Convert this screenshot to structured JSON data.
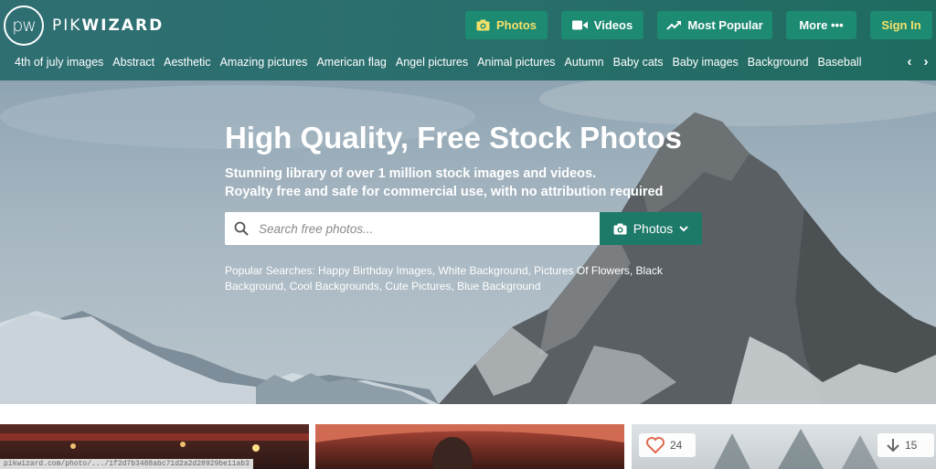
{
  "brand": {
    "logo_mark": "pw",
    "name_light": "PIK",
    "name_bold": "WIZARD"
  },
  "nav": {
    "photos": "Photos",
    "videos": "Videos",
    "most_popular": "Most Popular",
    "more": "More •••",
    "sign_in": "Sign In"
  },
  "categories": [
    "4th of july images",
    "Abstract",
    "Aesthetic",
    "Amazing pictures",
    "American flag",
    "Angel pictures",
    "Animal pictures",
    "Autumn",
    "Baby cats",
    "Baby images",
    "Background",
    "Baseball"
  ],
  "hero": {
    "title": "High Quality, Free Stock Photos",
    "subtitle_line1": "Stunning library of over 1 million stock images and videos.",
    "subtitle_line2": "Royalty free and safe for commercial use, with no attribution required"
  },
  "search": {
    "placeholder": "Search free photos...",
    "type_selected": "Photos"
  },
  "popular": {
    "line1": "Popular Searches: Happy Birthday Images, White Background, Pictures Of Flowers, Black",
    "line2": "Background, Cool Backgrounds, Cute Pictures, Blue Background"
  },
  "cards": {
    "likes": "24",
    "downloads": "15"
  },
  "status_url": "pikwizard.com/photo/.../1f2d7b3488abc71d2a2d28929be11ab3",
  "colors": {
    "topbar": "#2b6f6e",
    "button": "#1d8a72",
    "active_text": "#f3e16a",
    "search_type": "#1d7a68"
  }
}
